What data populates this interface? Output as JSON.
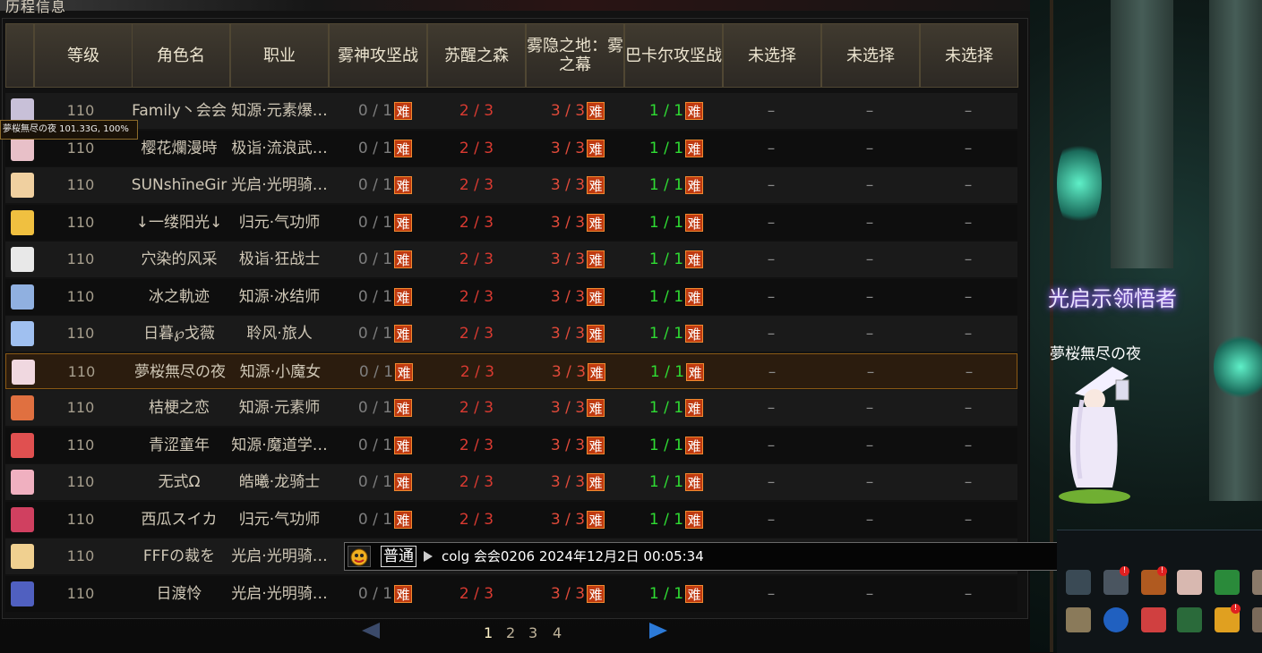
{
  "panel": {
    "title": "历程信息"
  },
  "headers": [
    "等级",
    "角色名",
    "职业",
    "雾神攻坚战",
    "苏醒之森",
    "雾隐之地：雾之幕",
    "巴卡尔攻坚战",
    "未选择",
    "未选择",
    "未选择"
  ],
  "difficulty_badge": "难",
  "unselected_mark": "–",
  "rows": [
    {
      "level": "110",
      "name": "Family丶会会",
      "job": "知源·元素爆…",
      "d1": "0 / 1",
      "d2": "2 / 3",
      "d3": "3 / 3",
      "d4": "1 / 1",
      "avatar_color": "#c8c0d8"
    },
    {
      "level": "110",
      "name": "樱花爛漫時",
      "job": "极诣·流浪武…",
      "d1": "0 / 1",
      "d2": "2 / 3",
      "d3": "3 / 3",
      "d4": "1 / 1",
      "avatar_color": "#e8c0c8"
    },
    {
      "level": "110",
      "name": "SUNshīneGir",
      "job": "光启·光明骑…",
      "d1": "0 / 1",
      "d2": "2 / 3",
      "d3": "3 / 3",
      "d4": "1 / 1",
      "avatar_color": "#f0d0a0"
    },
    {
      "level": "110",
      "name": "↓一缕阳光↓",
      "job": "归元·气功师",
      "d1": "0 / 1",
      "d2": "2 / 3",
      "d3": "3 / 3",
      "d4": "1 / 1",
      "avatar_color": "#f0c040"
    },
    {
      "level": "110",
      "name": "穴染的风采",
      "job": "极诣·狂战士",
      "d1": "0 / 1",
      "d2": "2 / 3",
      "d3": "3 / 3",
      "d4": "1 / 1",
      "avatar_color": "#e8e8e8"
    },
    {
      "level": "110",
      "name": "冰之軌迹",
      "job": "知源·冰结师",
      "d1": "0 / 1",
      "d2": "2 / 3",
      "d3": "3 / 3",
      "d4": "1 / 1",
      "avatar_color": "#90b0e0"
    },
    {
      "level": "110",
      "name": "日暮℘戈薇",
      "job": "聆风·旅人",
      "d1": "0 / 1",
      "d2": "2 / 3",
      "d3": "3 / 3",
      "d4": "1 / 1",
      "avatar_color": "#a0c0f0"
    },
    {
      "level": "110",
      "name": "夢桜無尽の夜",
      "job": "知源·小魔女",
      "d1": "0 / 1",
      "d2": "2 / 3",
      "d3": "3 / 3",
      "d4": "1 / 1",
      "avatar_color": "#f0d8e0",
      "selected": true
    },
    {
      "level": "110",
      "name": "桔梗之恋",
      "job": "知源·元素师",
      "d1": "0 / 1",
      "d2": "2 / 3",
      "d3": "3 / 3",
      "d4": "1 / 1",
      "avatar_color": "#e07040"
    },
    {
      "level": "110",
      "name": "青涩童年",
      "job": "知源·魔道学…",
      "d1": "0 / 1",
      "d2": "2 / 3",
      "d3": "3 / 3",
      "d4": "1 / 1",
      "avatar_color": "#e05050"
    },
    {
      "level": "110",
      "name": "无式Ω",
      "job": "皓曦·龙骑士",
      "d1": "0 / 1",
      "d2": "2 / 3",
      "d3": "3 / 3",
      "d4": "1 / 1",
      "avatar_color": "#f0b0c0"
    },
    {
      "level": "110",
      "name": "西瓜スイカ",
      "job": "归元·气功师",
      "d1": "0 / 1",
      "d2": "2 / 3",
      "d3": "3 / 3",
      "d4": "1 / 1",
      "avatar_color": "#d04060"
    },
    {
      "level": "110",
      "name": "FFFの裁を",
      "job": "光启·光明骑…",
      "d1": "",
      "d2": "",
      "d3": "",
      "d4": "",
      "avatar_color": "#f0d090"
    },
    {
      "level": "110",
      "name": "日渡怜",
      "job": "光启·光明骑…",
      "d1": "0 / 1",
      "d2": "2 / 3",
      "d3": "3 / 3",
      "d4": "1 / 1",
      "avatar_color": "#5060c0"
    }
  ],
  "tooltip": "夢桜無尽の夜  101.33G, 100%",
  "pagination": {
    "pages": [
      "1",
      "2",
      "3",
      "4"
    ],
    "current": "1"
  },
  "chat": {
    "channel": "普通",
    "message": "colg 会会0206  2024年12月2日 00:05:34"
  },
  "scene": {
    "character_title": "光启示领悟者",
    "character_name": "夢桜無尽の夜"
  },
  "colors": {
    "header_bg": "#403a2f",
    "selected_border": "#8b5a15",
    "badge_red": "#c03a10",
    "green_progress": "#2fdc33",
    "red_progress": "#d93a31"
  }
}
